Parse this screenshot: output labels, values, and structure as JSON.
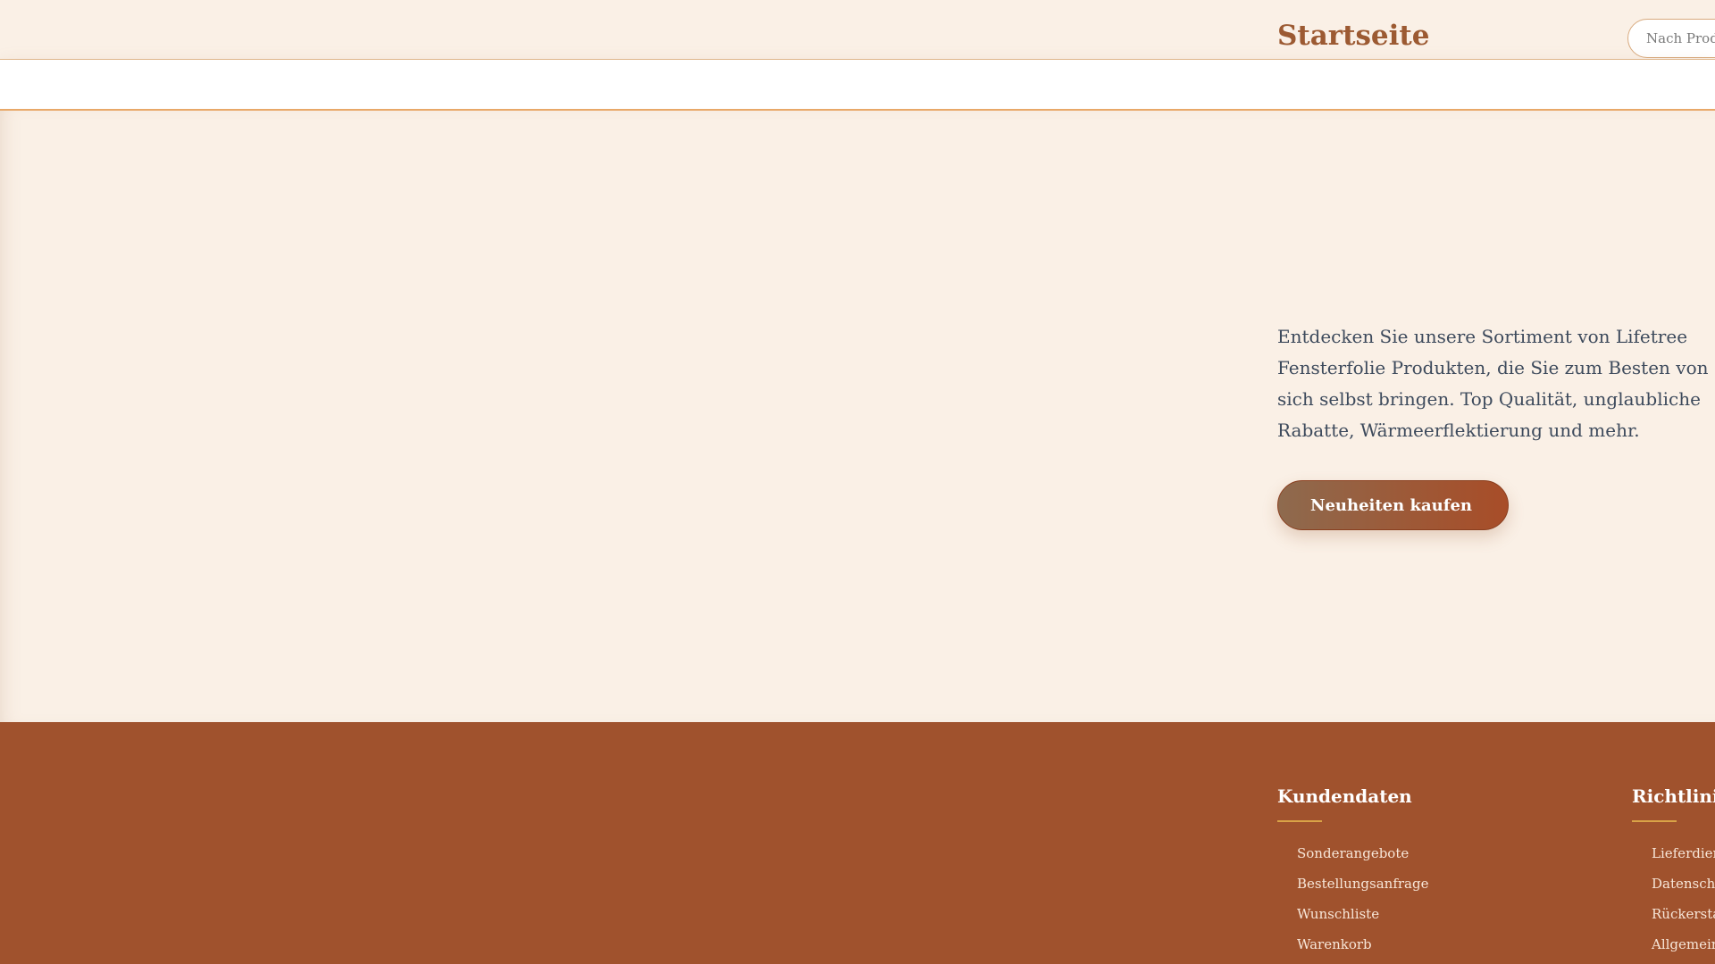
{
  "header": {
    "title": "Startseite",
    "search_placeholder": "Nach Produkten suchen"
  },
  "hero": {
    "text": "Entdecken Sie unsere Sortiment von Lifetree Fensterfolie Produkten, die Sie zum Besten von sich selbst bringen. Top Qualität, unglaubliche Rabatte, Wärmeerflektierung und mehr.",
    "cta_label": "Neuheiten kaufen"
  },
  "footer": {
    "columns": [
      {
        "heading": "Kundendaten",
        "links": [
          "Sonderangebote",
          "Bestellungsanfrage",
          "Wunschliste",
          "Warenkorb"
        ]
      },
      {
        "heading": "Richtlinien",
        "links": [
          "Lieferdienst",
          "Datenschutz",
          "Rückerstattung",
          "Allgemeine Geschäftsbedingungen"
        ]
      }
    ]
  },
  "colors": {
    "background": "#faf0e6",
    "brand": "#9c5a32",
    "footer": "#a0522d",
    "accent_line": "#d9a347",
    "body_text": "#3d4a5c"
  }
}
